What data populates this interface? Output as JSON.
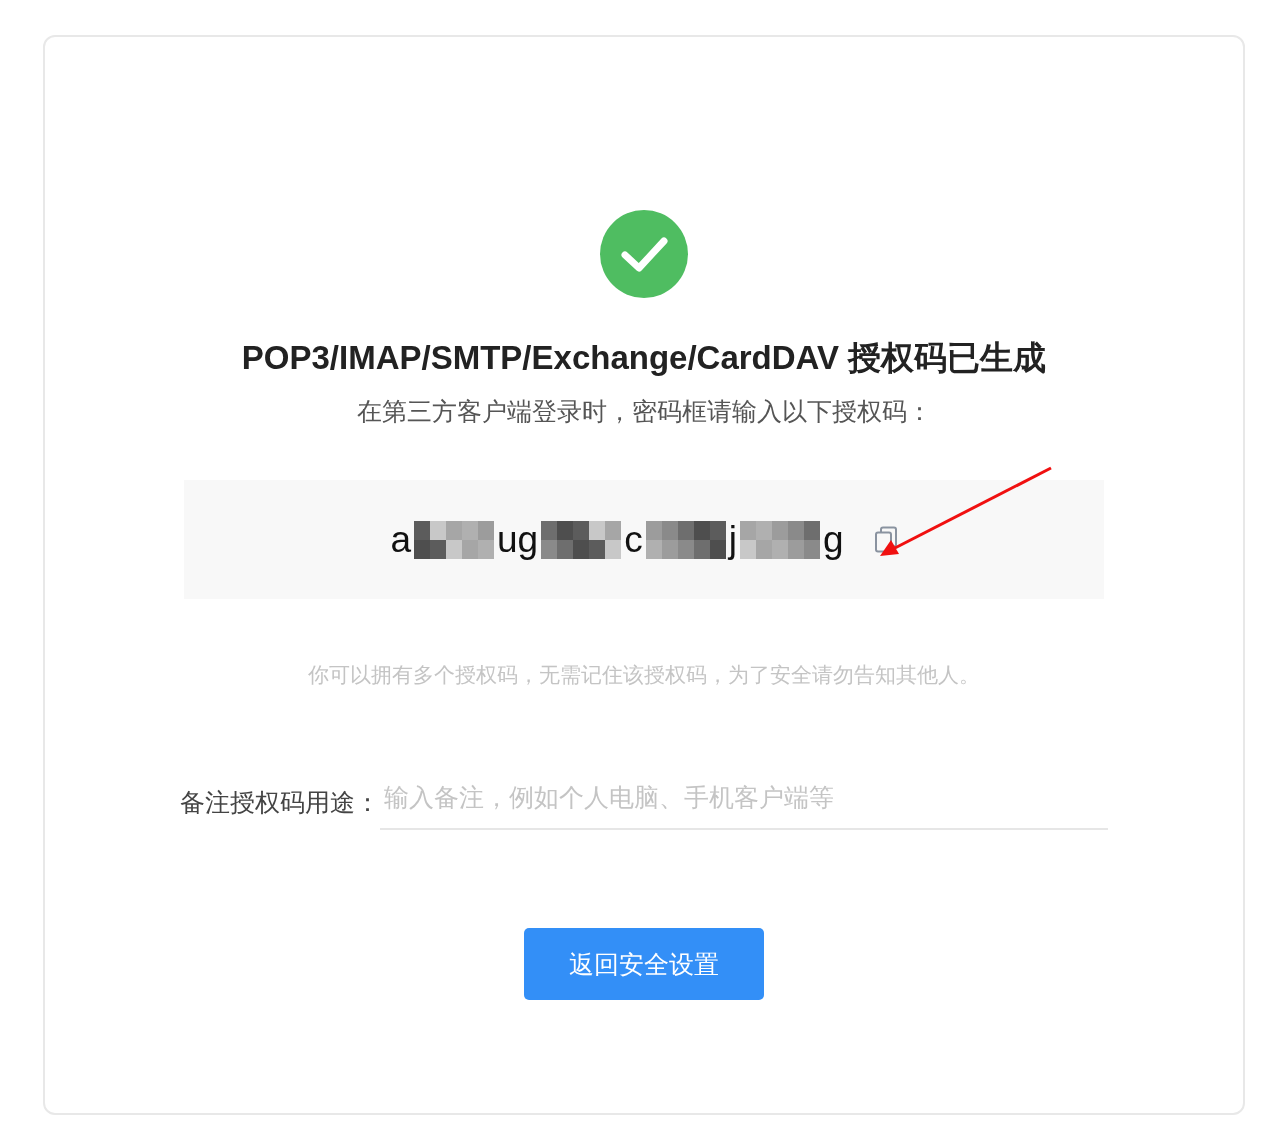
{
  "status_icon": {
    "kind": "success"
  },
  "title": "POP3/IMAP/SMTP/Exchange/CardDAV 授权码已生成",
  "subtitle": "在第三方客户端登录时，密码框请输入以下授权码：",
  "code_parts": [
    {
      "kind": "text",
      "text": "a"
    },
    {
      "kind": "redacted"
    },
    {
      "kind": "text",
      "text": "ug"
    },
    {
      "kind": "redacted"
    },
    {
      "kind": "text",
      "text": "c"
    },
    {
      "kind": "redacted"
    },
    {
      "kind": "text",
      "text": "j"
    },
    {
      "kind": "redacted"
    },
    {
      "kind": "text",
      "text": "g"
    }
  ],
  "note": "你可以拥有多个授权码，无需记住该授权码，为了安全请勿告知其他人。",
  "purpose_field": {
    "label": "备注授权码用途：",
    "placeholder": "输入备注，例如个人电脑、手机客户端等"
  },
  "button": "返回安全设置"
}
